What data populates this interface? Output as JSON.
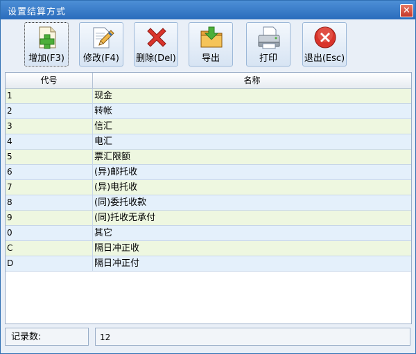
{
  "window": {
    "title": "设置结算方式",
    "close_glyph": "✕"
  },
  "toolbar": [
    {
      "label": "增加(F3)",
      "icon": "add-document-icon"
    },
    {
      "label": "修改(F4)",
      "icon": "edit-pencil-icon"
    },
    {
      "label": "删除(Del)",
      "icon": "delete-x-icon"
    },
    {
      "label": "导出",
      "icon": "export-folder-icon"
    },
    {
      "label": "打印",
      "icon": "printer-icon"
    },
    {
      "label": "退出(Esc)",
      "icon": "exit-circle-icon"
    }
  ],
  "grid": {
    "columns": [
      "代号",
      "名称"
    ],
    "rows": [
      {
        "code": "1",
        "name": "现金"
      },
      {
        "code": "2",
        "name": "转帐"
      },
      {
        "code": "3",
        "name": "信汇"
      },
      {
        "code": "4",
        "name": "电汇"
      },
      {
        "code": "5",
        "name": "票汇限额"
      },
      {
        "code": "6",
        "name": "(异)邮托收"
      },
      {
        "code": "7",
        "name": "(异)电托收"
      },
      {
        "code": "8",
        "name": "(同)委托收款"
      },
      {
        "code": "9",
        "name": "(同)托收无承付"
      },
      {
        "code": "0",
        "name": "其它"
      },
      {
        "code": "C",
        "name": "隔日冲正收"
      },
      {
        "code": "D",
        "name": "隔日冲正付"
      }
    ]
  },
  "status": {
    "count_label": "记录数:",
    "count_value": "12"
  },
  "colors": {
    "titlebar": "#3b7fcd",
    "row_odd": "#eef7e0",
    "row_even": "#e4f0fb",
    "delete_red": "#d9342b",
    "add_green": "#4caf3a"
  }
}
